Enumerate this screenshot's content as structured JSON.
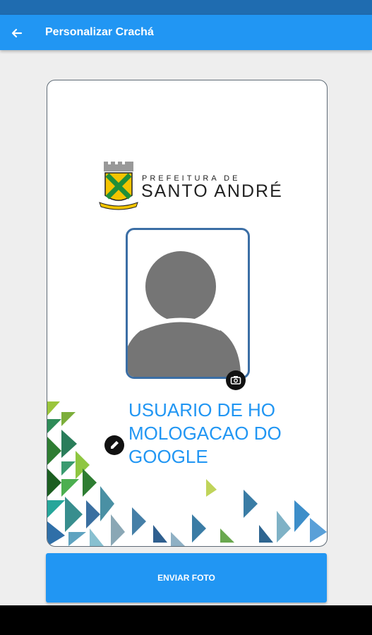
{
  "app_bar": {
    "title": "Personalizar Crachá",
    "back_icon": "arrow-left-icon"
  },
  "badge": {
    "logo_line1": "PREFEITURA DE",
    "logo_line2": "SANTO ANDRÉ",
    "user_name": "USUARIO DE HOMOLOGACAO DO GOOGLE",
    "camera_icon": "camera-switch-icon",
    "edit_icon": "pencil-icon"
  },
  "actions": {
    "send_label": "ENVIAR FOTO"
  },
  "colors": {
    "primary": "#2196f3",
    "status_bar": "#1f6cb0",
    "photo_border": "#3b6ea5",
    "name_text": "#2196f3"
  }
}
